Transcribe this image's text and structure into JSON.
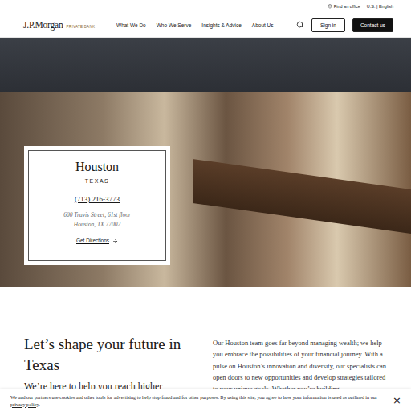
{
  "header": {
    "utility": {
      "office": "Find an office",
      "locale": "U.S. | English"
    },
    "logo": {
      "name": "J.P.Morgan",
      "sub": "PRIVATE BANK"
    },
    "nav": [
      "What We Do",
      "Who We Serve",
      "Insights & Advice",
      "About Us"
    ],
    "sign_in": "Sign in",
    "contact": "Contact us"
  },
  "card": {
    "city": "Houston",
    "state": "TEXAS",
    "phone": "(713) 216-3773",
    "address": [
      "600 Travis Street, 61st floor",
      "Houston, TX 77002"
    ],
    "link": "Get Directions"
  },
  "intro": {
    "heading": "Let’s shape your future in Texas",
    "subheading": "We’re here to help you reach higher",
    "body": "Our Houston team goes far beyond managing wealth; we help you embrace the possibilities of your financial journey. With a pulse on Houston’s innovation and diversity, our specialists can open doors to new opportunities and develop strategies tailored to your unique goals. Whether you’re building,"
  },
  "cookie": {
    "text": "We and our partners use cookies and other tools for advertising to help stop fraud and for other purposes. By using this site, you agree to how your information is used as outlined in our ",
    "link": "privacy policy",
    "after": ".",
    "close": "×"
  }
}
